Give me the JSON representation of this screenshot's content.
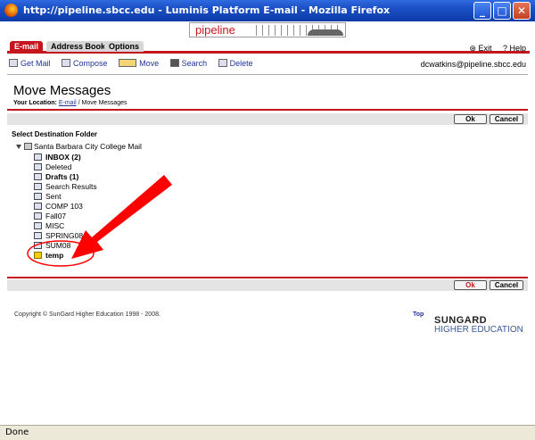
{
  "window": {
    "title": "http://pipeline.sbcc.edu - Luminis Platform E-mail - Mozilla Firefox"
  },
  "banner": {
    "logo_text": "pipeline"
  },
  "tabs": [
    {
      "label": "E-mail",
      "active": true
    },
    {
      "label": "Address Book",
      "active": false
    },
    {
      "label": "Options",
      "active": false
    }
  ],
  "top_links": {
    "exit": "Exit",
    "help": "Help"
  },
  "toolbar": {
    "get_mail": "Get Mail",
    "compose": "Compose",
    "move": "Move",
    "search": "Search",
    "delete": "Delete"
  },
  "user_email": "dcwatkins@pipeline.sbcc.edu",
  "page": {
    "title": "Move Messages",
    "location_label": "Your Location:",
    "location_link": "E-mail",
    "location_sep": " / ",
    "location_current": "Move Messages"
  },
  "buttons": {
    "ok": "Ok",
    "cancel": "Cancel"
  },
  "destination_label": "Select Destination Folder",
  "tree": {
    "root": "Santa Barbara City College Mail",
    "folders": [
      {
        "name": "INBOX (2)",
        "bold": true
      },
      {
        "name": "Deleted",
        "bold": false
      },
      {
        "name": "Drafts (1)",
        "bold": true
      },
      {
        "name": "Search Results",
        "bold": false
      },
      {
        "name": "Sent",
        "bold": false
      },
      {
        "name": "COMP 103",
        "bold": false
      },
      {
        "name": "Fall07",
        "bold": false
      },
      {
        "name": "MISC",
        "bold": false
      },
      {
        "name": "SPRING08",
        "bold": false
      },
      {
        "name": "SUM08",
        "bold": false
      },
      {
        "name": "temp",
        "bold": true,
        "selected": true
      }
    ]
  },
  "footer": {
    "copyright": "Copyright © SunGard Higher Education 1998 - 2008.",
    "top": "Top",
    "brand_line1": "SUNGARD",
    "brand_line2": "HIGHER EDUCATION"
  },
  "status": "Done",
  "colors": {
    "accent_red": "#c4161c",
    "link_blue": "#223399",
    "annotation_red": "#ff0000"
  }
}
